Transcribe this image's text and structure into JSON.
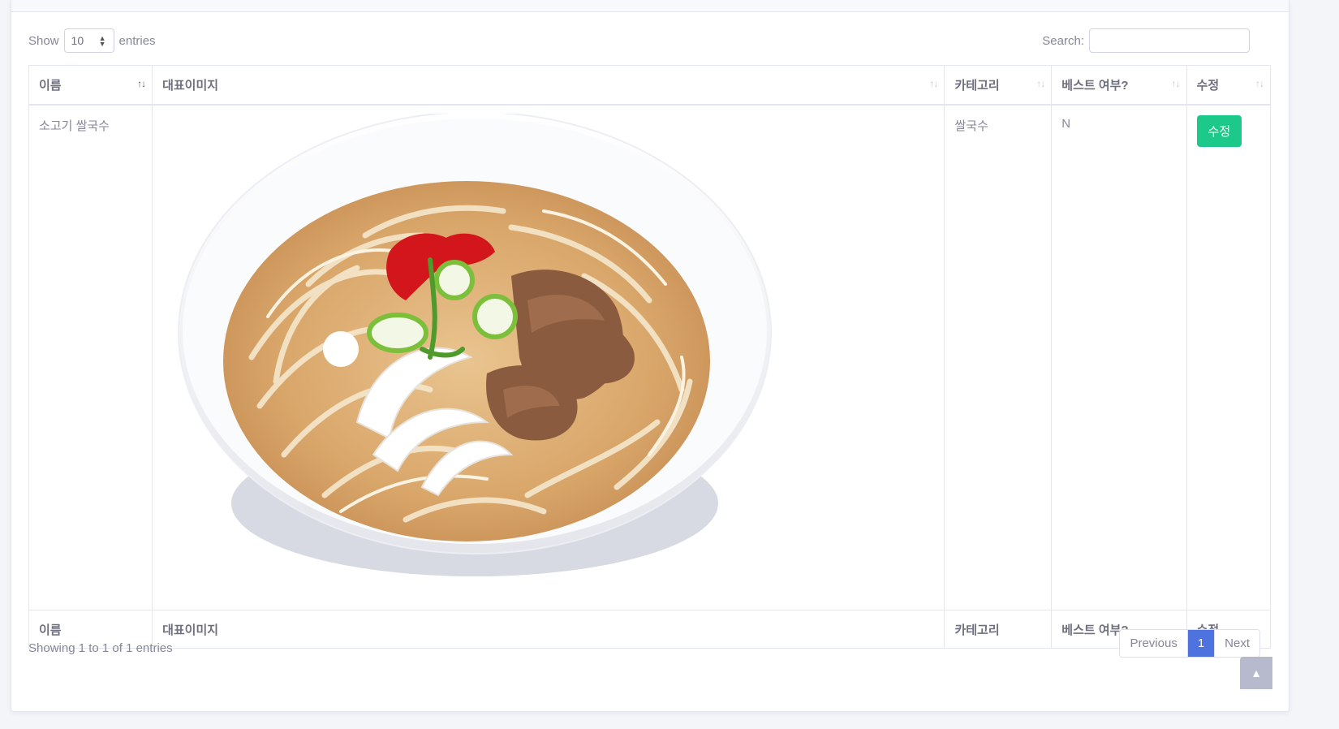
{
  "length_menu": {
    "show": "Show",
    "value": "10",
    "entries": "entries"
  },
  "search": {
    "label": "Search:",
    "value": ""
  },
  "table": {
    "headers": [
      "이름",
      "대표이미지",
      "카테고리",
      "베스트 여부?",
      "수정"
    ],
    "rows": [
      {
        "name": "소고기 쌀국수",
        "image": "beef-pho-bowl",
        "category": "쌀국수",
        "best": "N",
        "edit": "수정"
      }
    ]
  },
  "info": "Showing 1 to 1 of 1 entries",
  "pagination": {
    "previous": "Previous",
    "current": "1",
    "next": "Next"
  },
  "scroll_top_icon": "chevron-up-icon",
  "colors": {
    "edit_button": "#1cc88a",
    "page_active": "#4e73df"
  }
}
